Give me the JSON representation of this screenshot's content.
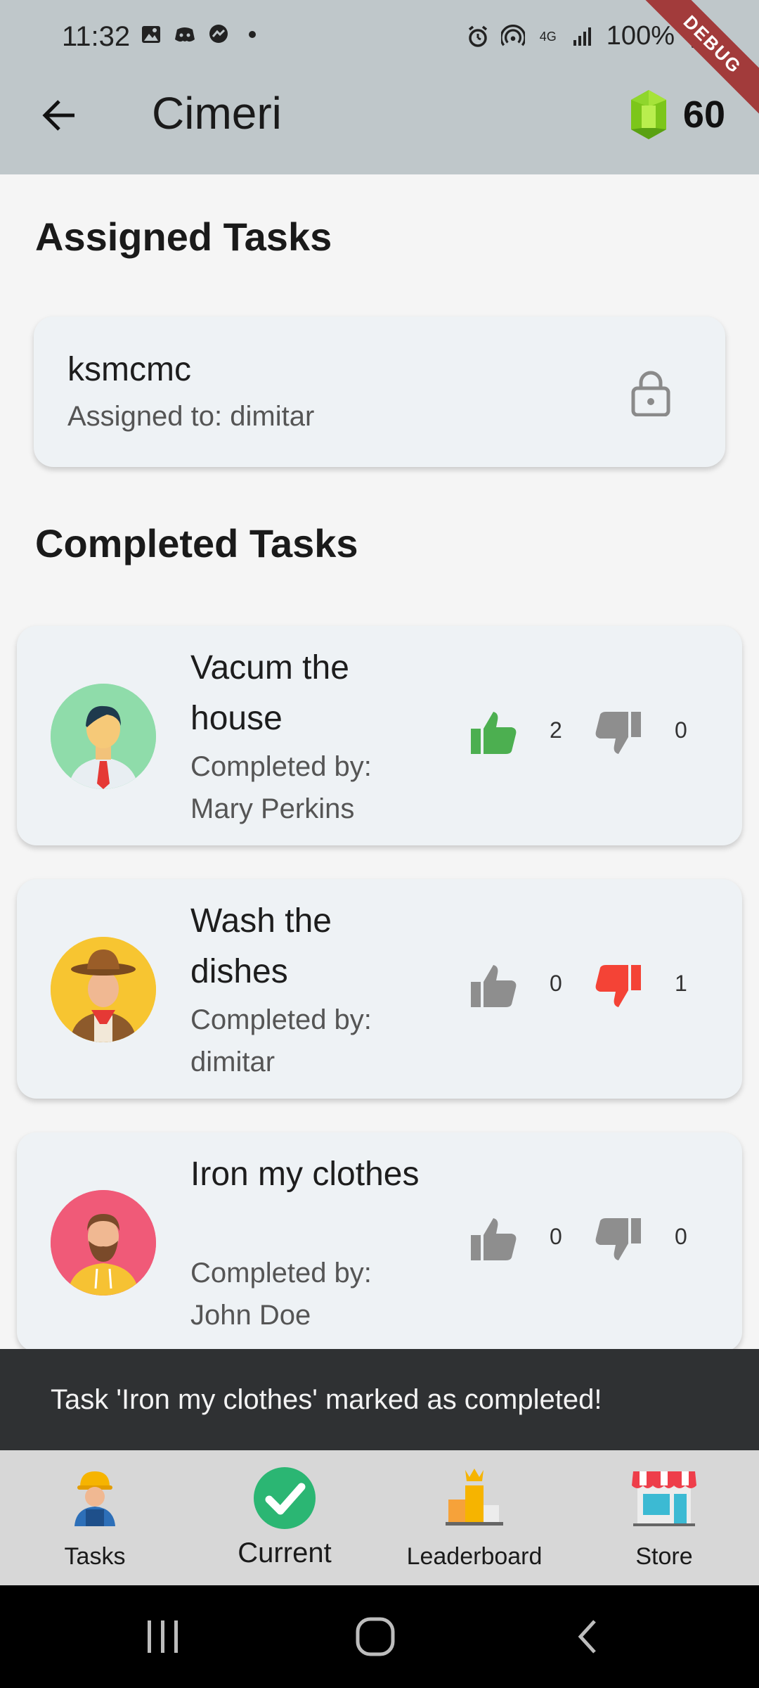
{
  "status_bar": {
    "time": "11:32",
    "battery": "100%",
    "network": "4G"
  },
  "debug_banner": "DEBUG",
  "app_bar": {
    "title": "Cimeri",
    "gem_count": "60"
  },
  "assigned": {
    "section_title": "Assigned Tasks",
    "tasks": [
      {
        "name": "ksmcmc",
        "assigned_text": "Assigned to: dimitar"
      }
    ]
  },
  "completed": {
    "section_title": "Completed Tasks",
    "tasks": [
      {
        "title": "Vacum the house",
        "completed_by": "Completed by: Mary Perkins",
        "likes": "2",
        "dislikes": "0",
        "liked": true,
        "disliked": false
      },
      {
        "title": "Wash the dishes",
        "completed_by": "Completed by: dimitar",
        "likes": "0",
        "dislikes": "1",
        "liked": false,
        "disliked": true
      },
      {
        "title": "Iron my clothes",
        "completed_by": "Completed by: John Doe",
        "likes": "0",
        "dislikes": "0",
        "liked": false,
        "disliked": false
      }
    ]
  },
  "snackbar": {
    "message": "Task 'Iron my clothes' marked as completed!"
  },
  "bottom_nav": {
    "items": [
      {
        "label": "Tasks"
      },
      {
        "label": "Current",
        "active": true
      },
      {
        "label": "Leaderboard"
      },
      {
        "label": "Store"
      }
    ]
  },
  "colors": {
    "app_bar": "#bfc7ca",
    "like_active": "#4caf50",
    "dislike_active": "#f44336",
    "vote_inactive": "#8e8e8e",
    "snackbar": "#2f3133"
  }
}
